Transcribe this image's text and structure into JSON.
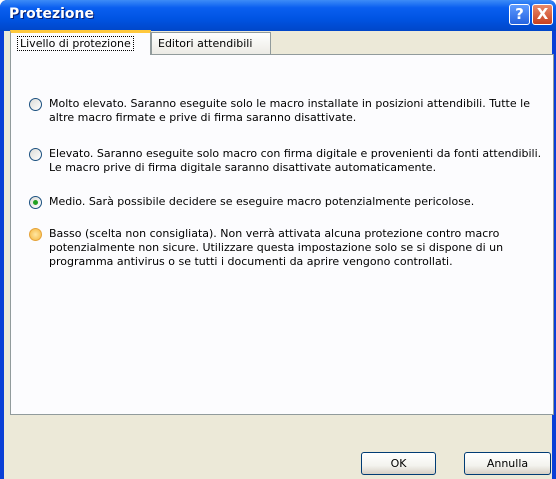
{
  "window": {
    "title": "Protezione"
  },
  "titlebar": {
    "help_glyph": "?",
    "close_glyph": "X"
  },
  "tabs": [
    {
      "label": "Livello di protezione",
      "active": true
    },
    {
      "label": "Editori attendibili",
      "active": false
    }
  ],
  "options": [
    {
      "text": "Molto elevato. Saranno eseguite solo le macro installate in posizioni attendibili. Tutte le altre macro firmate e prive di firma saranno disattivate.",
      "selected": false
    },
    {
      "text": "Elevato. Saranno eseguite solo macro con firma digitale e provenienti da fonti attendibili. Le macro prive di firma digitale saranno disattivate automaticamente.",
      "selected": false
    },
    {
      "text": "Medio. Sarà possibile decidere se eseguire macro potenzialmente pericolose.",
      "selected": true
    },
    {
      "text": "Basso (scelta non consigliata). Non verrà attivata alcuna protezione contro macro potenzialmente non sicure. Utilizzare questa impostazione solo se si dispone di un programma antivirus o se tutti i documenti da aprire vengono controllati.",
      "selected": false
    }
  ],
  "buttons": {
    "ok": "OK",
    "cancel": "Annulla"
  }
}
